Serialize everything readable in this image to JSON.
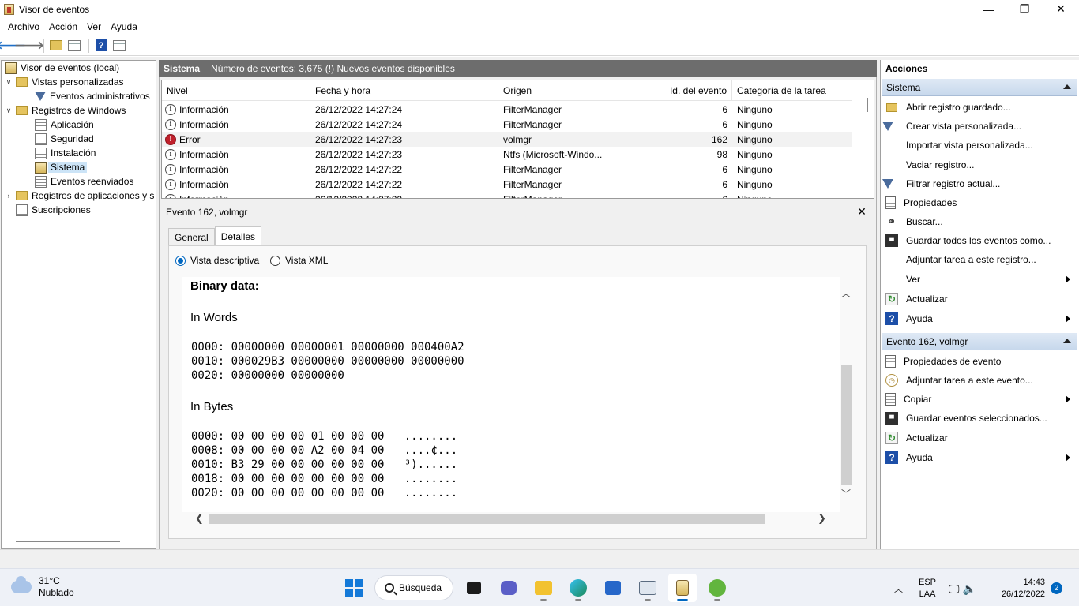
{
  "window": {
    "title": "Visor de eventos",
    "minimize": "—",
    "maximize": "❐",
    "close": "✕"
  },
  "menu": [
    "Archivo",
    "Acción",
    "Ver",
    "Ayuda"
  ],
  "tree": {
    "root": "Visor de eventos (local)",
    "custom_views": "Vistas personalizadas",
    "admin_events": "Eventos administrativos",
    "windows_logs": "Registros de Windows",
    "application": "Aplicación",
    "security": "Seguridad",
    "setup": "Instalación",
    "system": "Sistema",
    "forwarded": "Eventos reenviados",
    "app_logs": "Registros de aplicaciones y s",
    "subscriptions": "Suscripciones"
  },
  "center": {
    "title": "Sistema",
    "event_count": "Número de eventos: 3,675 (!) Nuevos eventos disponibles"
  },
  "grid": {
    "columns": [
      "Nivel",
      "Fecha y hora",
      "Origen",
      "Id. del evento",
      "Categoría de la tarea"
    ],
    "rows": [
      {
        "level": "Información",
        "date": "26/12/2022 14:27:24",
        "source": "FilterManager",
        "id": "6",
        "category": "Ninguno",
        "type": "info"
      },
      {
        "level": "Información",
        "date": "26/12/2022 14:27:24",
        "source": "FilterManager",
        "id": "6",
        "category": "Ninguno",
        "type": "info"
      },
      {
        "level": "Error",
        "date": "26/12/2022 14:27:23",
        "source": "volmgr",
        "id": "162",
        "category": "Ninguno",
        "type": "error"
      },
      {
        "level": "Información",
        "date": "26/12/2022 14:27:23",
        "source": "Ntfs (Microsoft-Windo...",
        "id": "98",
        "category": "Ninguno",
        "type": "info"
      },
      {
        "level": "Información",
        "date": "26/12/2022 14:27:22",
        "source": "FilterManager",
        "id": "6",
        "category": "Ninguno",
        "type": "info"
      },
      {
        "level": "Información",
        "date": "26/12/2022 14:27:22",
        "source": "FilterManager",
        "id": "6",
        "category": "Ninguno",
        "type": "info"
      },
      {
        "level": "Información",
        "date": "26/12/2022 14:27:22",
        "source": "FilterManager",
        "id": "6",
        "category": "Ninguno",
        "type": "info"
      }
    ]
  },
  "detail": {
    "title": "Evento 162, volmgr",
    "tabs": [
      "General",
      "Detalles"
    ],
    "radio_friendly": "Vista descriptiva",
    "radio_xml": "Vista XML",
    "binary_title": "Binary data:",
    "in_words": "In Words",
    "words_lines": [
      "0000: 00000000 00000001 00000000 000400A2",
      "0010: 000029B3 00000000 00000000 00000000",
      "0020: 00000000 00000000"
    ],
    "in_bytes": "In Bytes",
    "bytes_lines": [
      "0000: 00 00 00 00 01 00 00 00   ........",
      "0008: 00 00 00 00 A2 00 04 00   ....¢...",
      "0010: B3 29 00 00 00 00 00 00   ³)......",
      "0018: 00 00 00 00 00 00 00 00   ........",
      "0020: 00 00 00 00 00 00 00 00   ........"
    ]
  },
  "actions": {
    "title": "Acciones",
    "section1": "Sistema",
    "items1": [
      "Abrir registro guardado...",
      "Crear vista personalizada...",
      "Importar vista personalizada...",
      "Vaciar registro...",
      "Filtrar registro actual...",
      "Propiedades",
      "Buscar...",
      "Guardar todos los eventos como...",
      "Adjuntar tarea a este registro...",
      "Ver",
      "Actualizar",
      "Ayuda"
    ],
    "section2": "Evento 162, volmgr",
    "items2": [
      "Propiedades de evento",
      "Adjuntar tarea a este evento...",
      "Copiar",
      "Guardar eventos seleccionados...",
      "Actualizar",
      "Ayuda"
    ]
  },
  "taskbar": {
    "temp": "31°C",
    "weather": "Nublado",
    "search": "Búsqueda",
    "lang1": "ESP",
    "lang2": "LAA",
    "time": "14:43",
    "date": "26/12/2022",
    "notifications": "2"
  }
}
